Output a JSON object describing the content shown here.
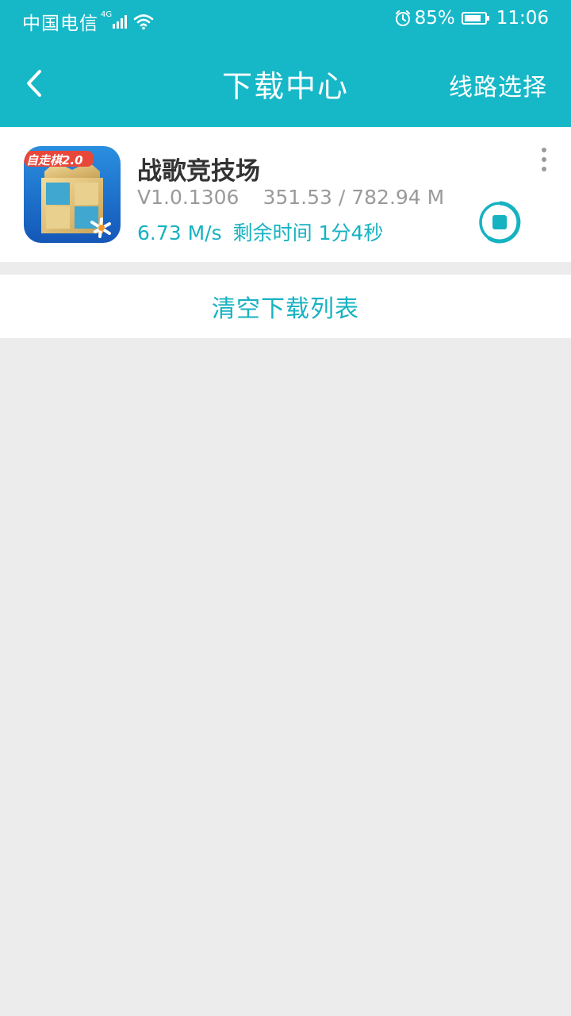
{
  "status_bar": {
    "carrier": "中国电信",
    "network": "4G",
    "battery_percent": "85%",
    "battery_level": 0.85,
    "time": "11:06",
    "icons": [
      "signal-icon",
      "wifi-icon",
      "alarm-icon",
      "battery-icon"
    ]
  },
  "header": {
    "back_icon": "chevron-left-icon",
    "title": "下载中心",
    "route_select_label": "线路选择",
    "background_color": "#16b8c8"
  },
  "download_item": {
    "app_name": "战歌竞技场",
    "app_icon_badge": "自走棋2.0",
    "version": "V1.0.1306",
    "progress_text": "351.53 / 782.94 M",
    "speed": "6.73 M/s",
    "remaining_time": "剩余时间 1分4秒",
    "more_icon": "more-vertical-icon",
    "action_icon": "stop-icon",
    "accent_color": "#16b2c2"
  },
  "clear_list_label": "清空下载列表"
}
